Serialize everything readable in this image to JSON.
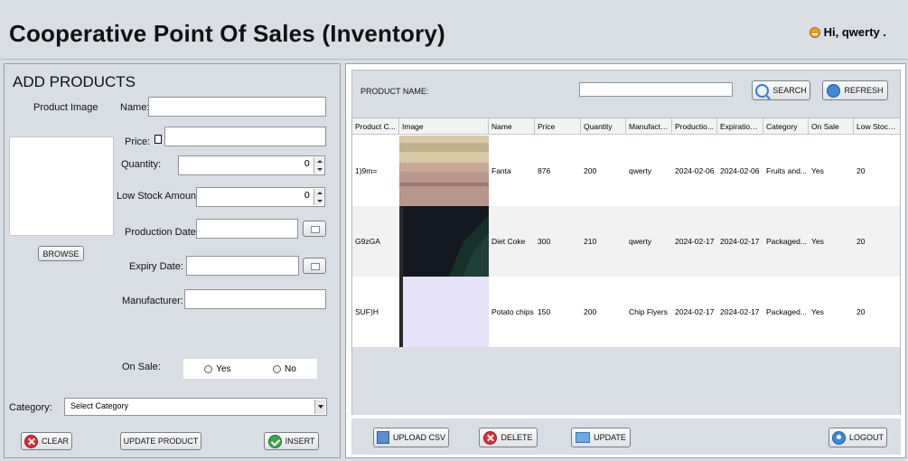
{
  "header": {
    "title": "Cooperative Point Of Sales (Inventory)",
    "greeting": "Hi, qwerty  ."
  },
  "add_form": {
    "heading": "ADD PRODUCTS",
    "product_image_label": "Product Image",
    "name_label": "Name:",
    "name_value": "",
    "price_label": "Price:",
    "price_value": "",
    "quantity_label": "Quantity:",
    "quantity_value": "0",
    "low_stock_label": "Low Stock Amount:",
    "low_stock_value": "0",
    "production_date_label": "Production Date:",
    "production_date_value": "",
    "expiry_date_label": "Expiry Date:",
    "expiry_date_value": "",
    "manufacturer_label": "Manufacturer:",
    "manufacturer_value": "",
    "browse_label": "BROWSE",
    "on_sale_label": "On Sale:",
    "on_sale_yes": "Yes",
    "on_sale_no": "No",
    "category_label": "Category:",
    "category_value": "Select Category",
    "clear_label": "CLEAR",
    "update_product_label": "UPDATE PRODUCT",
    "insert_label": "INSERT"
  },
  "search": {
    "label": "PRODUCT NAME:",
    "value": "",
    "search_label": "SEARCH",
    "refresh_label": "REFRESH"
  },
  "table": {
    "columns": [
      "Product C...",
      "Image",
      "Name",
      "Price",
      "Quantity",
      "Manufactu...",
      "Productio...",
      "Expiration ...",
      "Category",
      "On Sale",
      "Low Stock..."
    ],
    "rows": [
      {
        "code": "1)9m=",
        "name": "Fanta",
        "price": "876",
        "quantity": "200",
        "manufacturer": "qwerty",
        "production": "2024-02-06",
        "expiration": "2024-02-06",
        "category": "Fruits and...",
        "on_sale": "Yes",
        "low_stock": "20"
      },
      {
        "code": "G9zGA",
        "name": "Diet Coke",
        "price": "300",
        "quantity": "210",
        "manufacturer": "qwerty",
        "production": "2024-02-17",
        "expiration": "2024-02-17",
        "category": "Packaged...",
        "on_sale": "Yes",
        "low_stock": "20"
      },
      {
        "code": "SUF)H",
        "name": "Potato chips",
        "price": "150",
        "quantity": "200",
        "manufacturer": "Chip Flyers",
        "production": "2024-02-17",
        "expiration": "2024-02-17",
        "category": "Packaged...",
        "on_sale": "Yes",
        "low_stock": "20"
      }
    ]
  },
  "actions": {
    "upload_csv_label": "UPLOAD CSV",
    "delete_label": "DELETE",
    "update_label": "UPDATE",
    "logout_label": "LOGOUT"
  },
  "colors": {
    "background": "#d9dde4",
    "accent_red": "#d8313a",
    "accent_green": "#3aa84a",
    "accent_blue": "#3a8ad8"
  }
}
